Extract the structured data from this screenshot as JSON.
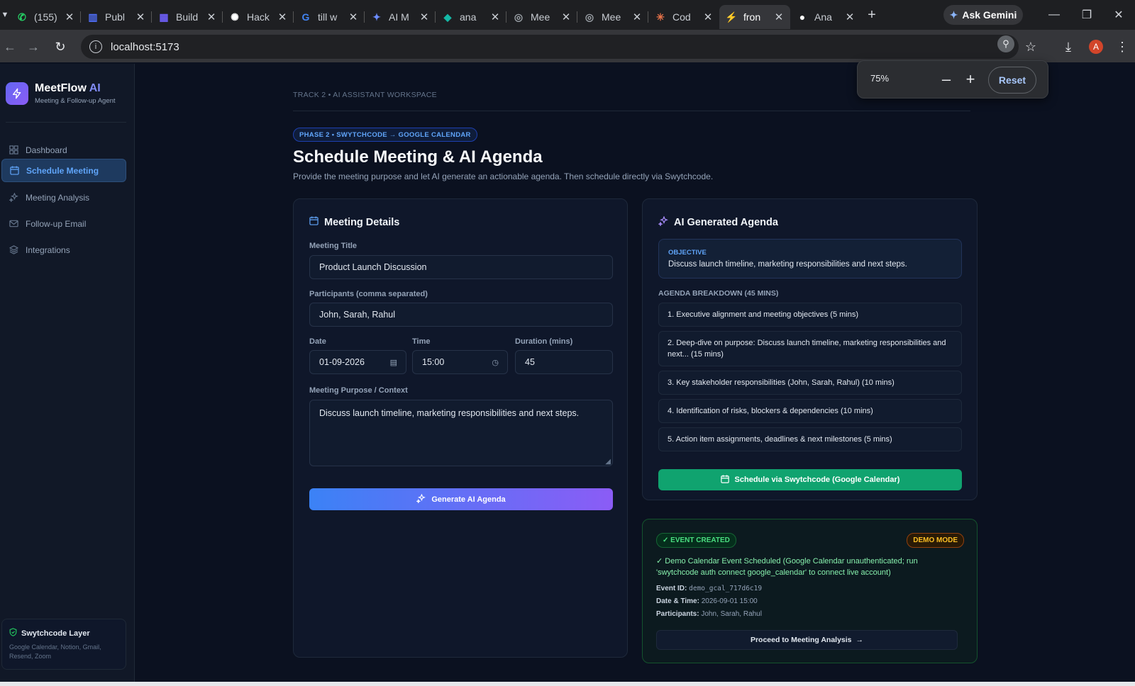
{
  "browser": {
    "tabs": [
      {
        "label": "(155)",
        "icon": "whatsapp-icon",
        "color": "#25d366"
      },
      {
        "label": "Publ",
        "icon": "bars-icon",
        "color": "#4f6ef7"
      },
      {
        "label": "Build",
        "icon": "grid-icon",
        "color": "#6d5ef7"
      },
      {
        "label": "Hack",
        "icon": "openai-icon",
        "color": "#ffffff"
      },
      {
        "label": "till w",
        "icon": "google-icon",
        "color": "#4285f4"
      },
      {
        "label": "AI M",
        "icon": "gemini-icon",
        "color": "#6b8cff"
      },
      {
        "label": "ana",
        "icon": "diamond-icon",
        "color": "#14b8a6"
      },
      {
        "label": "Mee",
        "icon": "globe-icon",
        "color": "#9aa0a6"
      },
      {
        "label": "Mee",
        "icon": "globe-icon",
        "color": "#9aa0a6"
      },
      {
        "label": "Cod",
        "icon": "claude-icon",
        "color": "#e8734a"
      },
      {
        "label": "fron",
        "icon": "vite-icon",
        "color": "#a855f7"
      },
      {
        "label": "Ana",
        "icon": "github-icon",
        "color": "#ffffff"
      }
    ],
    "active_tab_index": 10,
    "ask_gemini": "Ask Gemini",
    "url": "localhost:5173",
    "zoom": {
      "value": "75%",
      "reset": "Reset"
    }
  },
  "sidebar": {
    "brand_name": "MeetFlow",
    "brand_ai": "AI",
    "brand_sub": "Meeting & Follow-up Agent",
    "items": [
      {
        "label": "Dashboard",
        "icon": "grid-icon"
      },
      {
        "label": "Schedule Meeting",
        "icon": "calendar-icon"
      },
      {
        "label": "Meeting Analysis",
        "icon": "sparkles-icon"
      },
      {
        "label": "Follow-up Email",
        "icon": "mail-icon"
      },
      {
        "label": "Integrations",
        "icon": "layers-icon"
      }
    ],
    "active_index": 1,
    "swytch_title": "Swytchcode Layer",
    "swytch_sub": "Google Calendar, Notion, Gmail, Resend, Zoom"
  },
  "header": {
    "topline": "TRACK 2 • AI ASSISTANT WORKSPACE",
    "phase": "PHASE 2 • SWYTCHCODE → GOOGLE CALENDAR",
    "title": "Schedule Meeting & AI Agenda",
    "subtitle": "Provide the meeting purpose and let AI generate an actionable agenda. Then schedule directly via Swytchcode."
  },
  "details": {
    "title": "Meeting Details",
    "title_label": "Meeting Title",
    "title_value": "Product Launch Discussion",
    "participants_label": "Participants (comma separated)",
    "participants_value": "John, Sarah, Rahul",
    "date_label": "Date",
    "date_value": "01-09-2026",
    "time_label": "Time",
    "time_value": "15:00",
    "duration_label": "Duration (mins)",
    "duration_value": "45",
    "purpose_label": "Meeting Purpose / Context",
    "purpose_value": "Discuss launch timeline, marketing responsibilities and next steps.",
    "generate_label": "Generate AI Agenda"
  },
  "agenda": {
    "title": "AI Generated Agenda",
    "objective_label": "OBJECTIVE",
    "objective_text": "Discuss launch timeline, marketing responsibilities and next steps.",
    "breakdown_label": "AGENDA BREAKDOWN (45 MINS)",
    "items": [
      "1. Executive alignment and meeting objectives (5 mins)",
      "2. Deep-dive on purpose: Discuss launch timeline, marketing responsibilities and next... (15 mins)",
      "3. Key stakeholder responsibilities (John, Sarah, Rahul) (10 mins)",
      "4. Identification of risks, blockers & dependencies (10 mins)",
      "5. Action item assignments, deadlines & next milestones (5 mins)"
    ],
    "schedule_label": "Schedule via Swytchcode (Google Calendar)"
  },
  "event": {
    "created_badge": "✓ EVENT CREATED",
    "demo_badge": "DEMO MODE",
    "message": "✓ Demo Calendar Event Scheduled (Google Calendar unauthenticated; run 'swytchcode auth connect google_calendar' to connect live account)",
    "event_id_label": "Event ID:",
    "event_id": "demo_gcal_717d6c19",
    "datetime_label": "Date & Time:",
    "datetime": "2026-09-01 15:00",
    "participants_label": "Participants:",
    "participants": "John, Sarah, Rahul",
    "proceed_label": "Proceed to Meeting Analysis"
  },
  "colors": {
    "accent": "#3b82f6",
    "brand_gradient_end": "#8b5cf6",
    "success": "#10a36f",
    "warning": "#fbbf24",
    "background": "#0b1120"
  }
}
